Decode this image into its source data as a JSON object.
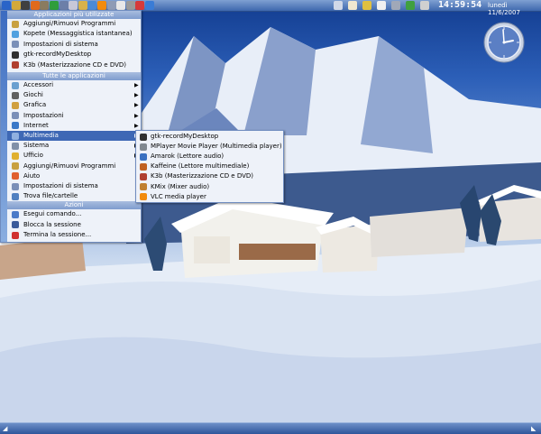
{
  "top_panel": {
    "time": "14:59:54",
    "date": "lunedì 11/6/2007",
    "launchers": [
      {
        "icon": "k-menu-icon",
        "color": "#2a64c8"
      },
      {
        "icon": "pencil-icon",
        "color": "#d4a93a"
      },
      {
        "icon": "terminal-icon",
        "color": "#404040"
      },
      {
        "icon": "firefox-icon",
        "color": "#e06a1d"
      },
      {
        "icon": "gimp-icon",
        "color": "#8a7b5f"
      },
      {
        "icon": "spreadsheet-icon",
        "color": "#2f9d3b"
      },
      {
        "icon": "monitor-icon",
        "color": "#6c7fa8"
      },
      {
        "icon": "mail-icon",
        "color": "#c8c8d8"
      },
      {
        "icon": "home-folder-icon",
        "color": "#d8b24a"
      },
      {
        "icon": "chat-icon",
        "color": "#4b8ad6"
      },
      {
        "icon": "vlc-icon",
        "color": "#f28b0c"
      },
      {
        "icon": "settings-icon",
        "color": "#8e9bb5"
      },
      {
        "icon": "document-icon",
        "color": "#e8e8e8"
      },
      {
        "icon": "trash-icon",
        "color": "#9a9a9a"
      },
      {
        "icon": "help-icon",
        "color": "#d63a3a"
      },
      {
        "icon": "network-icon",
        "color": "#3a7cd6"
      }
    ],
    "tray": [
      {
        "icon": "keyboard-layout-icon",
        "color": "#d0d8e8"
      },
      {
        "icon": "klipper-icon",
        "color": "#f0e8d0"
      },
      {
        "icon": "volume-icon",
        "color": "#e0c040"
      },
      {
        "icon": "update-icon",
        "color": "#f0f0f0"
      },
      {
        "icon": "printer-icon",
        "color": "#a0a8b8"
      },
      {
        "icon": "power-icon",
        "color": "#40a040"
      },
      {
        "icon": "disk-icon",
        "color": "#d0d0d0"
      }
    ]
  },
  "menu": {
    "favorites_header": "Applicazioni più utilizzate",
    "favorites": [
      {
        "label": "Aggiungi/Rimuovi Programmi",
        "icon": "package-icon",
        "color": "#c8a040"
      },
      {
        "label": "Kopete (Messaggistica istantanea)",
        "icon": "kopete-icon",
        "color": "#50a0e0"
      },
      {
        "label": "Impostazioni di sistema",
        "icon": "settings-icon",
        "color": "#7a8fb8"
      },
      {
        "label": "gtk-recordMyDesktop",
        "icon": "record-icon",
        "color": "#303030"
      },
      {
        "label": "K3b (Masterizzazione CD e DVD)",
        "icon": "k3b-icon",
        "color": "#b04030"
      }
    ],
    "all_header": "Tutte le applicazioni",
    "categories": [
      {
        "label": "Accessori",
        "icon": "accessories-icon",
        "color": "#6aa0d0",
        "submenu": true
      },
      {
        "label": "Giochi",
        "icon": "games-icon",
        "color": "#606060",
        "submenu": true
      },
      {
        "label": "Grafica",
        "icon": "graphics-icon",
        "color": "#d0a040",
        "submenu": true
      },
      {
        "label": "Impostazioni",
        "icon": "settings-icon",
        "color": "#7a8fb8",
        "submenu": true
      },
      {
        "label": "Internet",
        "icon": "internet-icon",
        "color": "#3a78c8",
        "submenu": true
      },
      {
        "label": "Multimedia",
        "icon": "multimedia-icon",
        "color": "#90b0e0",
        "submenu": true,
        "highlighted": true
      },
      {
        "label": "Sistema",
        "icon": "system-icon",
        "color": "#8090a8",
        "submenu": true
      },
      {
        "label": "Ufficio",
        "icon": "office-icon",
        "color": "#e0b030",
        "submenu": true
      },
      {
        "label": "Aggiungi/Rimuovi Programmi",
        "icon": "package-icon",
        "color": "#c8a040",
        "submenu": false
      },
      {
        "label": "Aiuto",
        "icon": "help-icon",
        "color": "#e06030",
        "submenu": false
      },
      {
        "label": "Impostazioni di sistema",
        "icon": "settings-icon",
        "color": "#7a8fb8",
        "submenu": false
      },
      {
        "label": "Trova file/cartelle",
        "icon": "search-icon",
        "color": "#5080c0",
        "submenu": false
      }
    ],
    "actions_header": "Azioni",
    "actions": [
      {
        "label": "Esegui comando...",
        "icon": "run-icon",
        "color": "#4a7ac8"
      },
      {
        "label": "Blocca la sessione",
        "icon": "lock-icon",
        "color": "#3a5a9a"
      },
      {
        "label": "Termina la sessione...",
        "icon": "logout-icon",
        "color": "#d03030"
      }
    ]
  },
  "multimedia_submenu": [
    {
      "label": "gtk-recordMyDesktop",
      "icon": "record-icon",
      "color": "#303030"
    },
    {
      "label": "MPlayer Movie Player (Multimedia player)",
      "icon": "mplayer-icon",
      "color": "#808890"
    },
    {
      "label": "Amarok (Lettore audio)",
      "icon": "amarok-icon",
      "color": "#3a70c0"
    },
    {
      "label": "Kaffeine (Lettore multimediale)",
      "icon": "kaffeine-icon",
      "color": "#c06020"
    },
    {
      "label": "K3b (Masterizzazione CD e DVD)",
      "icon": "k3b-icon",
      "color": "#b04030"
    },
    {
      "label": "KMix (Mixer audio)",
      "icon": "kmix-icon",
      "color": "#c08030"
    },
    {
      "label": "VLC media player",
      "icon": "vlc-icon",
      "color": "#f28b0c"
    }
  ]
}
